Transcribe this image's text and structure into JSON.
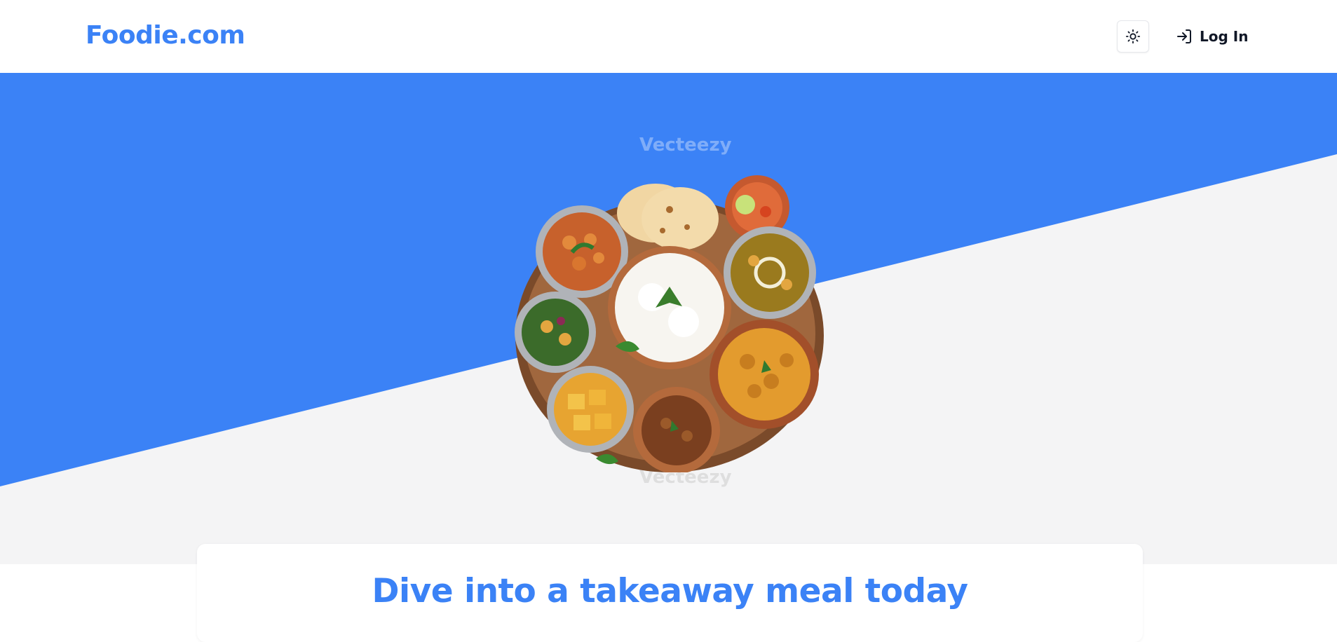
{
  "header": {
    "brand": "Foodie.com",
    "theme_toggle_icon": "sun-icon",
    "login_icon": "login-arrow-icon",
    "login_label": "Log In"
  },
  "hero": {
    "image_description_icon": "thali-plate-image",
    "watermark_text": "Vecteezy",
    "colors": {
      "accent": "#3b82f6",
      "band": "#3b82f6",
      "background": "#f4f4f5"
    }
  },
  "card": {
    "title": "Dive into a takeaway meal today"
  }
}
